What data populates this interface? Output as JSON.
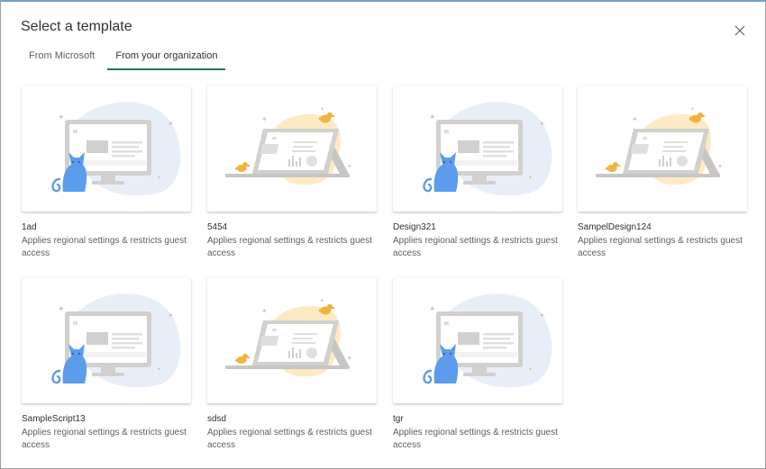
{
  "dialog": {
    "title": "Select a template",
    "close_icon": "close-icon"
  },
  "tabs": [
    {
      "label": "From Microsoft",
      "active": false
    },
    {
      "label": "From your organization",
      "active": true
    }
  ],
  "colors": {
    "tab_underline": "#1e7a52",
    "cat": "#5b9cec",
    "bird": "#f2b33d",
    "monitor_blob": "#e8eef8",
    "tablet_blob": "#fde9c4"
  },
  "templates": [
    {
      "name": "1ad",
      "description": "Applies regional settings & restricts guest access",
      "illustration": "cat-monitor-illustration"
    },
    {
      "name": "5454",
      "description": "Applies regional settings & restricts guest access",
      "illustration": "bird-tablet-illustration"
    },
    {
      "name": "Design321",
      "description": "Applies regional settings & restricts guest access",
      "illustration": "cat-monitor-illustration"
    },
    {
      "name": "SampelDesign124",
      "description": "Applies regional settings & restricts guest access",
      "illustration": "bird-tablet-illustration"
    },
    {
      "name": "SampleScript13",
      "description": "Applies regional settings & restricts guest access",
      "illustration": "cat-monitor-illustration"
    },
    {
      "name": "sdsd",
      "description": "Applies regional settings & restricts guest access",
      "illustration": "bird-tablet-illustration"
    },
    {
      "name": "tgr",
      "description": "Applies regional settings & restricts guest access",
      "illustration": "cat-monitor-illustration"
    }
  ]
}
